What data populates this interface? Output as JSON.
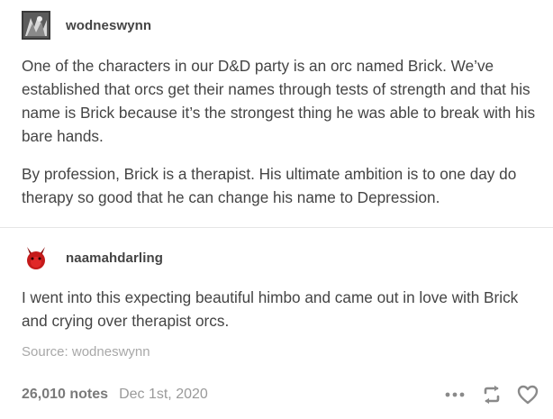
{
  "post": {
    "original": {
      "username": "wodneswynn",
      "paragraphs": [
        "One of the characters in our D&D party is an orc named Brick. We’ve established that orcs get their names through tests of strength and that his name is Brick because it’s the strongest thing he was able to break with his bare hands.",
        "By profession, Brick is a therapist.  His ultimate ambition is to one day do therapy so good that he can change his name to Depression."
      ]
    },
    "reblog": {
      "username": "naamahdarling",
      "text": "I went into this expecting beautiful himbo and came out in love with Brick and crying over therapist orcs."
    },
    "source": "Source: wodneswynn",
    "footer": {
      "notes": "26,010 notes",
      "date": "Dec 1st, 2020"
    },
    "icons": {
      "more": "more-dots-icon",
      "reblog": "reblog-icon",
      "like": "heart-icon"
    }
  }
}
